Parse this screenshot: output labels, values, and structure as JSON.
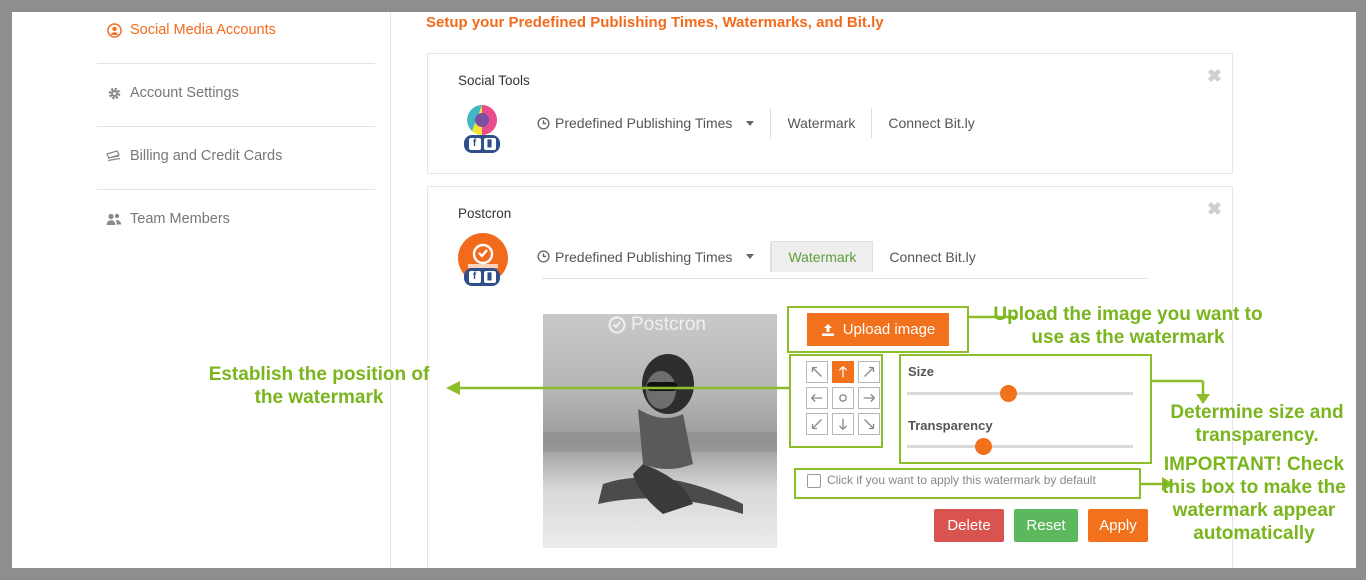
{
  "sidebar": {
    "items": [
      {
        "label": "Social Media Accounts",
        "icon": "user-circle-icon"
      },
      {
        "label": "Account Settings",
        "icon": "gear-icon"
      },
      {
        "label": "Billing and Credit Cards",
        "icon": "money-icon"
      },
      {
        "label": "Team Members",
        "icon": "users-icon"
      }
    ]
  },
  "main": {
    "heading": "Setup your Predefined Publishing Times, Watermarks, and Bit.ly",
    "cards": [
      {
        "title": "Social Tools",
        "tabs": [
          "Predefined Publishing Times",
          "Watermark",
          "Connect Bit.ly"
        ],
        "close": "✖"
      },
      {
        "title": "Postcron",
        "tabs": [
          "Predefined Publishing Times",
          "Watermark",
          "Connect Bit.ly"
        ],
        "active_tab": "Watermark",
        "close": "✖"
      }
    ],
    "watermark": {
      "image_watermark_text": "Postcron",
      "upload_label": "Upload image",
      "size_label": "Size",
      "size_value": 0.45,
      "transparency_label": "Transparency",
      "transparency_value": 0.34,
      "default_checkbox_label": "Click if you want to apply this watermark by default",
      "position_selected": "top-center",
      "delete_label": "Delete",
      "reset_label": "Reset",
      "apply_label": "Apply"
    }
  },
  "annotations": {
    "upload": "Upload the image you want to use as  the watermark",
    "position": "Establish the position of  the watermark",
    "size": "Determine size and transparency.",
    "important": "IMPORTANT! Check this box to make the watermark appear automatically"
  },
  "colors": {
    "accent": "#f26b1d",
    "annotation": "#7ab51d",
    "delete": "#d9534f",
    "reset": "#5cb85c"
  }
}
